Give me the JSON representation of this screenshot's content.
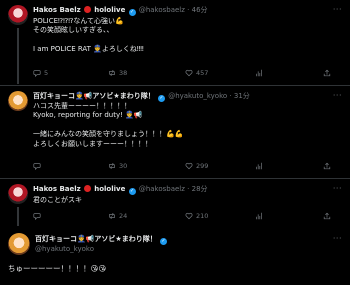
{
  "tweets": [
    {
      "name": "Hakos Baelz",
      "brand": "hololive",
      "handle": "@hakosbaelz",
      "time": "46分",
      "text": "POLICE⁉⁉⁉なんて心強い💪\nその笑顔眩しいすぎる、、\n\nI am POLICE RAT 👮よろしくね‼‼",
      "replies": "5",
      "retweets": "38",
      "likes": "457"
    },
    {
      "name": "百灯キョーコ👮📢アソビ★まわり隊！",
      "handle": "@hyakuto_kyoko",
      "time": "31分",
      "text": "ハコス先輩ーーーー！！！！！\nKyoko, reporting for duty! 👮📢\n\n一緒にみんなの笑顔を守りましょう！！！💪💪\nよろしくお願いしますーーー！！！！",
      "replies": "",
      "retweets": "30",
      "likes": "299"
    },
    {
      "name": "Hakos Baelz",
      "brand": "hololive",
      "handle": "@hakosbaelz",
      "time": "28分",
      "text": "君のことがスキ",
      "replies": "",
      "retweets": "24",
      "likes": "210"
    },
    {
      "name": "百灯キョーコ👮📢アソビ★まわり隊！",
      "handle": "@hyakuto_kyoko",
      "time": "",
      "text": "ちゅーーーーー！！！！😘😘"
    }
  ],
  "icons": [
    "reply-icon",
    "retweet-icon",
    "like-icon",
    "views-icon",
    "more-icon",
    "verified-icon"
  ]
}
